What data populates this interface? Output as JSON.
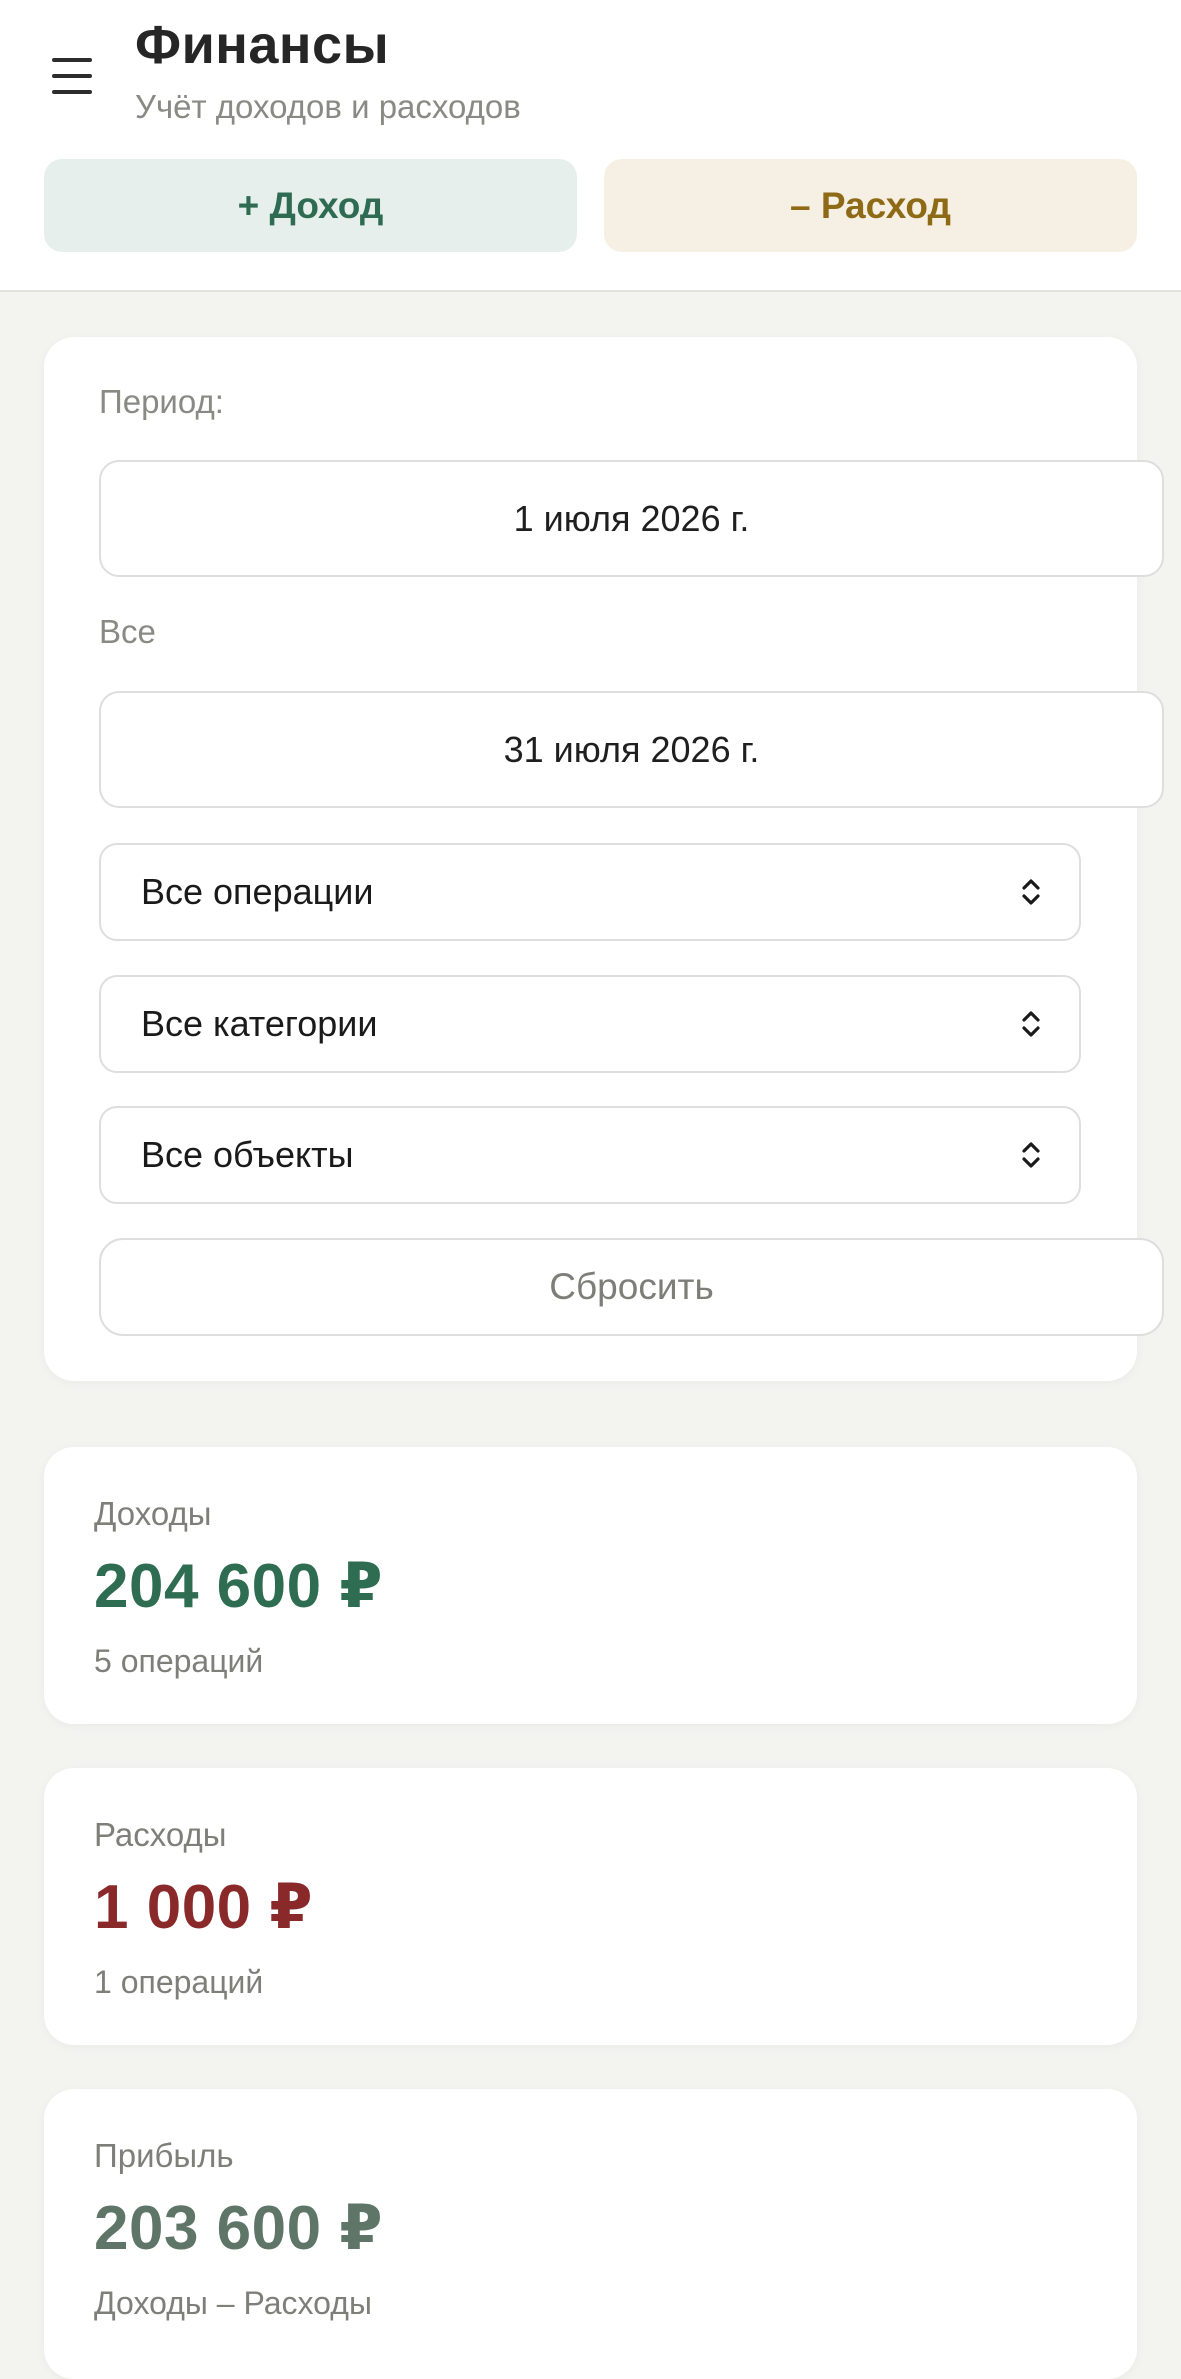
{
  "header": {
    "title": "Финансы",
    "subtitle": "Учёт доходов и расходов",
    "income_button": "+ Доход",
    "expense_button": "– Расход"
  },
  "filters": {
    "period_label": "Период:",
    "date_from": "1 июля 2026 г.",
    "to_label": "Все",
    "date_to": "31 июля 2026 г.",
    "operation_select": "Все операции",
    "category_select": "Все категории",
    "object_select": "Все объекты",
    "reset_button": "Сбросить"
  },
  "summary": {
    "income": {
      "label": "Доходы",
      "value": "204 600 ₽",
      "note": "5 операций",
      "color": "#2f6d52"
    },
    "expense": {
      "label": "Расходы",
      "value": "1 000 ₽",
      "note": "1 операций",
      "color": "#8a2929"
    },
    "profit": {
      "label": "Прибыль",
      "value": "203 600 ₽",
      "note": "Доходы – Расходы",
      "color": "#5e7568"
    }
  },
  "icons": {
    "menu": "hamburger-menu-icon",
    "select": "chevron-up-down-icon"
  }
}
